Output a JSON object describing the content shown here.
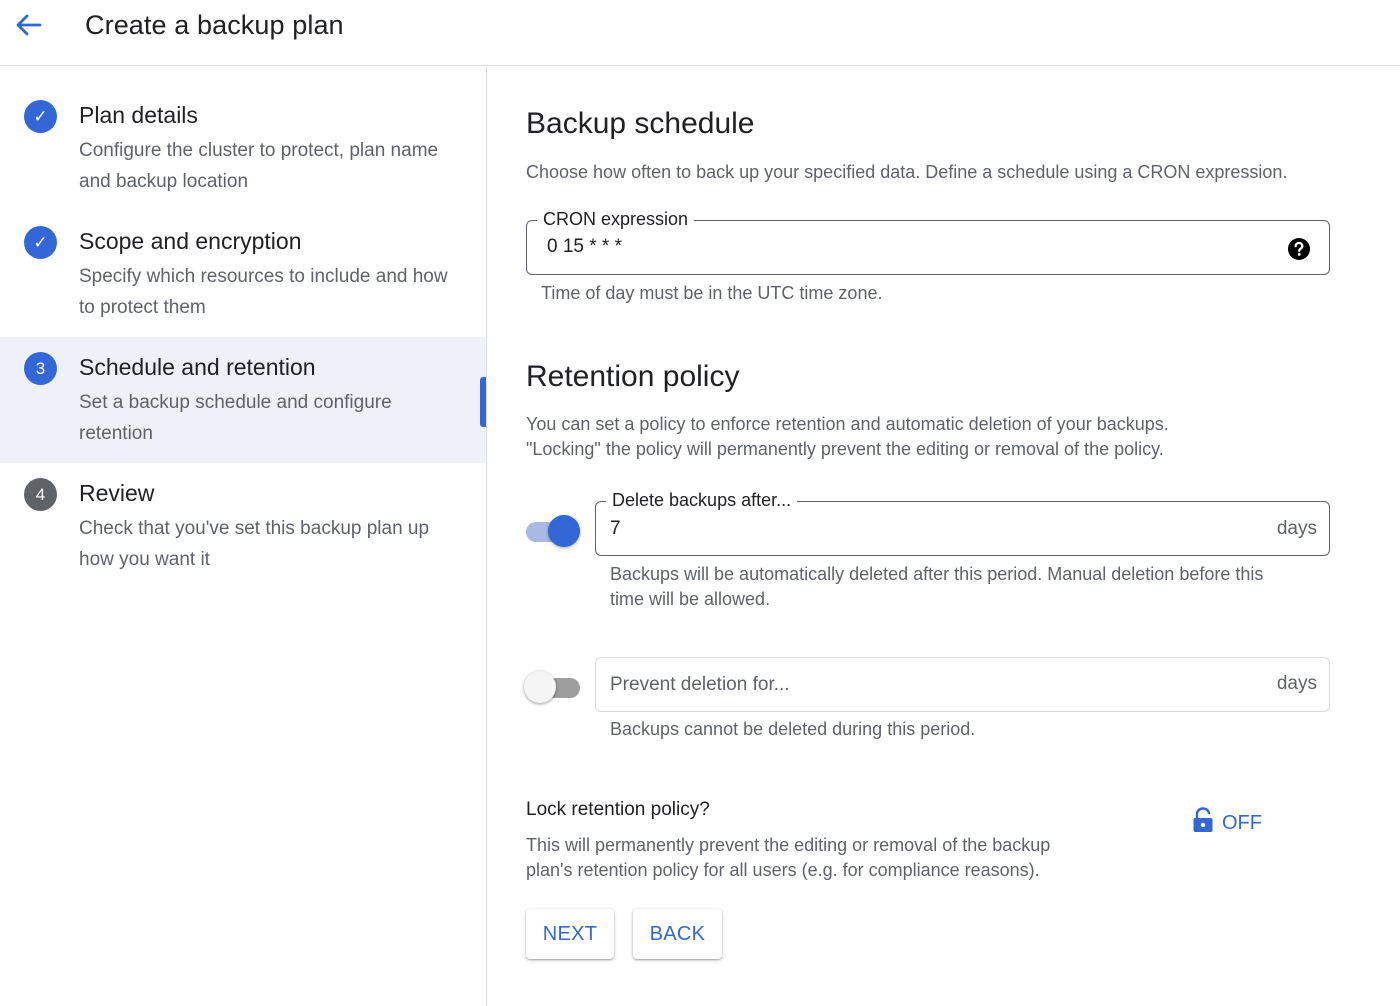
{
  "header": {
    "title": "Create a backup plan"
  },
  "sidebar": {
    "steps": [
      {
        "indicator": "✓",
        "state": "done",
        "title": "Plan details",
        "description": "Configure the cluster to protect, plan name and backup location"
      },
      {
        "indicator": "✓",
        "state": "done",
        "title": "Scope and encryption",
        "description": "Specify which resources to include and how to protect them"
      },
      {
        "indicator": "3",
        "state": "current",
        "title": "Schedule and retention",
        "description": "Set a backup schedule and configure retention"
      },
      {
        "indicator": "4",
        "state": "pending",
        "title": "Review",
        "description": "Check that you've set this backup plan up how you want it"
      }
    ]
  },
  "schedule": {
    "title": "Backup schedule",
    "description": "Choose how often to back up your specified data. Define a schedule using a CRON expression.",
    "cron_label": "CRON expression",
    "cron_value": "0 15 * * *",
    "cron_hint": "Time of day must be in the UTC time zone.",
    "help_icon": "help-circle-icon"
  },
  "retention": {
    "title": "Retention policy",
    "description_line1": "You can set a policy to enforce retention and automatic deletion of your backups.",
    "description_line2": "\"Locking\" the policy will permanently prevent the editing or removal of the policy.",
    "delete_after": {
      "enabled": true,
      "label": "Delete backups after...",
      "value": "7",
      "suffix": "days",
      "hint_line1": "Backups will be automatically deleted after this period. Manual deletion before this",
      "hint_line2": "time will be allowed."
    },
    "prevent_deletion": {
      "enabled": false,
      "placeholder": "Prevent deletion for...",
      "suffix": "days",
      "hint": "Backups cannot be deleted during this period."
    }
  },
  "lock": {
    "title": "Lock retention policy?",
    "description_line1": "This will permanently prevent the editing or removal of the backup",
    "description_line2": "plan's retention policy for all users (e.g. for compliance reasons).",
    "state_label": "OFF",
    "icon": "lock-open-icon"
  },
  "actions": {
    "next_label": "NEXT",
    "back_label": "BACK"
  },
  "colors": {
    "accent": "#3367d6",
    "active_step_bg": "#eef1f8"
  }
}
